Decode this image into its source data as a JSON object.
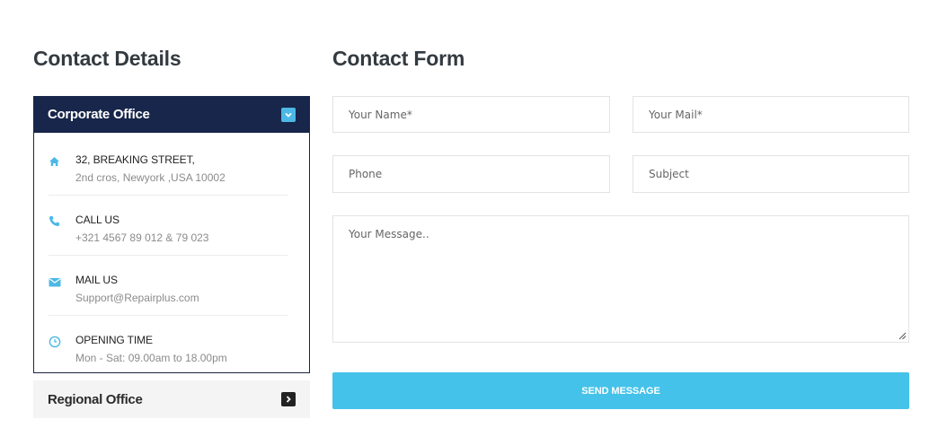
{
  "contact_details": {
    "heading": "Contact Details",
    "corporate": {
      "title": "Corporate Office",
      "toggle_icon": "chevron-down-icon",
      "items": [
        {
          "icon": "home-icon",
          "title": "32, BREAKING STREET,",
          "text": "2nd cros, Newyork ,USA 10002"
        },
        {
          "icon": "phone-icon",
          "title": "CALL US",
          "text": "+321 4567 89 012 & 79 023"
        },
        {
          "icon": "mail-icon",
          "title": "MAIL US",
          "text": "Support@Repairplus.com"
        },
        {
          "icon": "clock-icon",
          "title": "OPENING TIME",
          "text": "Mon - Sat: 09.00am to 18.00pm"
        }
      ]
    },
    "regional": {
      "title": "Regional Office",
      "toggle_icon": "chevron-right-icon"
    }
  },
  "contact_form": {
    "heading": "Contact Form",
    "fields": {
      "name": {
        "placeholder": "Your Name*",
        "value": ""
      },
      "mail": {
        "placeholder": "Your Mail*",
        "value": ""
      },
      "phone": {
        "placeholder": "Phone",
        "value": ""
      },
      "subject": {
        "placeholder": "Subject",
        "value": ""
      },
      "message": {
        "placeholder": "Your Message..",
        "value": ""
      }
    },
    "submit_label": "SEND MESSAGE"
  },
  "colors": {
    "accent": "#44c2e9",
    "navy": "#17264a",
    "icon_blue": "#4cb8e6",
    "heading": "#333a40"
  }
}
